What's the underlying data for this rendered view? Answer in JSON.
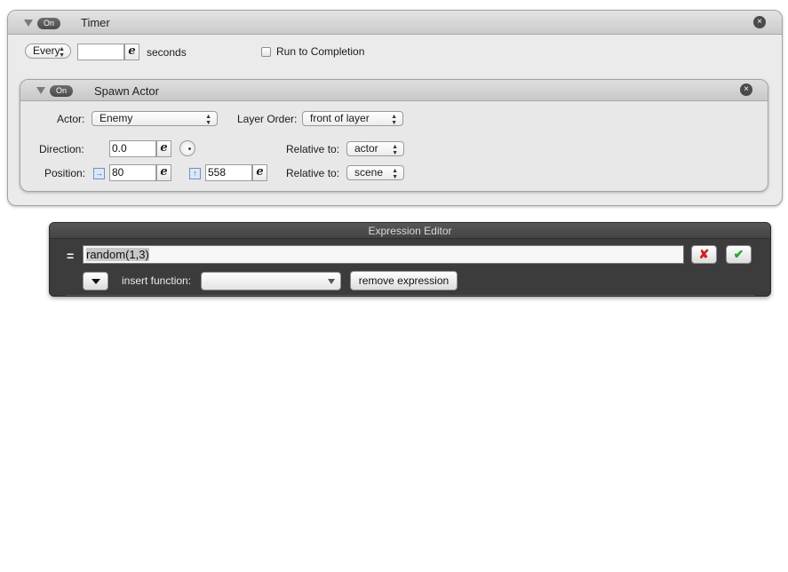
{
  "timer": {
    "toggle": "On",
    "title": "Timer",
    "mode": "Every",
    "seconds_value": "",
    "seconds_label": "seconds",
    "run_to_completion_label": "Run to Completion",
    "run_to_completion_checked": false
  },
  "spawn_actor": {
    "toggle": "On",
    "title": "Spawn Actor",
    "actor_label": "Actor:",
    "actor_value": "Enemy",
    "layer_order_label": "Layer Order:",
    "layer_order_value": "front of layer",
    "direction_label": "Direction:",
    "direction_value": "0.0",
    "direction_relative_label": "Relative to:",
    "direction_relative_value": "actor",
    "position_label": "Position:",
    "position_x": "80",
    "position_y": "558",
    "position_relative_label": "Relative to:",
    "position_relative_value": "scene"
  },
  "expression_editor": {
    "title": "Expression Editor",
    "equals": "=",
    "expression": "random(1,3)",
    "insert_function_label": "insert function:",
    "insert_function_value": "",
    "remove_button": "remove expression",
    "cancel_color": "#d21f1f",
    "confirm_color": "#2aa52a"
  },
  "icons": {
    "expression_button": "e",
    "close": "×",
    "cancel": "✘",
    "confirm": "✔",
    "x_axis": "→",
    "y_axis": "↑"
  }
}
